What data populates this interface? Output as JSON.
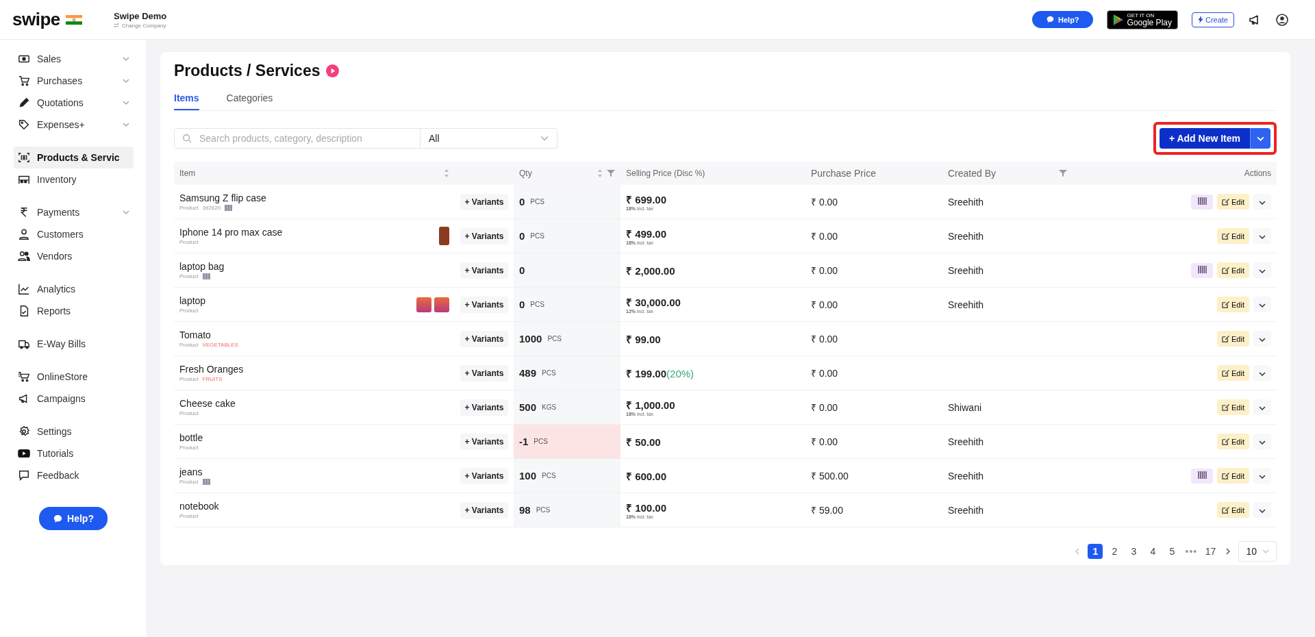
{
  "header": {
    "logo": "swipe",
    "company": "Swipe Demo",
    "change_company": "Change Company",
    "help": "Help?",
    "store_badge": {
      "small": "GET IT ON",
      "big": "Google Play"
    },
    "create": "Create"
  },
  "sidebar": {
    "groups": [
      {
        "items": [
          {
            "label": "Sales",
            "expandable": true,
            "selected": false
          },
          {
            "label": "Purchases",
            "expandable": true,
            "selected": false
          },
          {
            "label": "Quotations",
            "expandable": true,
            "selected": false
          },
          {
            "label": "Expenses+",
            "expandable": true,
            "selected": false
          }
        ]
      },
      {
        "items": [
          {
            "label": "Products & Servic",
            "expandable": false,
            "selected": true
          },
          {
            "label": "Inventory",
            "expandable": false,
            "selected": false
          }
        ]
      },
      {
        "items": [
          {
            "label": "Payments",
            "expandable": true,
            "selected": false
          },
          {
            "label": "Customers",
            "expandable": false,
            "selected": false
          },
          {
            "label": "Vendors",
            "expandable": false,
            "selected": false
          }
        ]
      },
      {
        "items": [
          {
            "label": "Analytics",
            "expandable": false,
            "selected": false
          },
          {
            "label": "Reports",
            "expandable": false,
            "selected": false
          }
        ]
      },
      {
        "items": [
          {
            "label": "E-Way Bills",
            "expandable": false,
            "selected": false
          }
        ]
      },
      {
        "items": [
          {
            "label": "OnlineStore",
            "expandable": false,
            "selected": false
          },
          {
            "label": "Campaigns",
            "expandable": false,
            "selected": false
          }
        ]
      },
      {
        "items": [
          {
            "label": "Settings",
            "expandable": false,
            "selected": false
          },
          {
            "label": "Tutorials",
            "expandable": false,
            "selected": false
          },
          {
            "label": "Feedback",
            "expandable": false,
            "selected": false
          }
        ]
      }
    ],
    "help": "Help?"
  },
  "page": {
    "title": "Products / Services",
    "tabs": [
      {
        "label": "Items",
        "selected": true
      },
      {
        "label": "Categories",
        "selected": false
      }
    ],
    "search": {
      "placeholder": "Search products, category, description"
    },
    "filter": {
      "value": "All"
    },
    "add_button": "+ Add New Item",
    "table": {
      "columns": [
        "Item",
        "Qty",
        "Selling Price (Disc %)",
        "Purchase Price",
        "Created By",
        "Actions"
      ],
      "rows": [
        {
          "name": "Samsung Z flip case",
          "type": "Product",
          "code": "392620",
          "category": "",
          "barcode": true,
          "thumbnails": [],
          "variants": "+ Variants",
          "qty": "0",
          "unit": "PCS",
          "negative": false,
          "price": "₹ 699.00",
          "discount": "",
          "tax_rate": "18%",
          "tax_note": "incl. tax",
          "purchase": "₹ 0.00",
          "created_by": "Sreehith",
          "barcode_action": true,
          "edit": "Edit"
        },
        {
          "name": "Iphone 14 pro max case",
          "type": "Product",
          "code": "",
          "category": "",
          "barcode": false,
          "thumbnails": [
            {
              "kind": "phone"
            }
          ],
          "variants": "+ Variants",
          "qty": "0",
          "unit": "PCS",
          "negative": false,
          "price": "₹ 499.00",
          "discount": "",
          "tax_rate": "18%",
          "tax_note": "incl. tax",
          "purchase": "₹ 0.00",
          "created_by": "Sreehith",
          "barcode_action": false,
          "edit": "Edit"
        },
        {
          "name": "laptop bag",
          "type": "Product",
          "code": "",
          "category": "",
          "barcode": true,
          "thumbnails": [],
          "variants": "+ Variants",
          "qty": "0",
          "unit": "",
          "negative": false,
          "price": "₹ 2,000.00",
          "discount": "",
          "tax_rate": "",
          "tax_note": "",
          "purchase": "₹ 0.00",
          "created_by": "Sreehith",
          "barcode_action": true,
          "edit": "Edit"
        },
        {
          "name": "laptop",
          "type": "Product",
          "code": "",
          "category": "",
          "barcode": false,
          "thumbnails": [
            {
              "kind": "laptop"
            },
            {
              "kind": "laptop"
            }
          ],
          "variants": "+ Variants",
          "qty": "0",
          "unit": "PCS",
          "negative": false,
          "price": "₹ 30,000.00",
          "discount": "",
          "tax_rate": "12%",
          "tax_note": "incl. tax",
          "purchase": "₹ 0.00",
          "created_by": "Sreehith",
          "barcode_action": false,
          "edit": "Edit"
        },
        {
          "name": "Tomato",
          "type": "Product",
          "code": "",
          "category": "VEGETABLES",
          "barcode": false,
          "thumbnails": [],
          "variants": "+ Variants",
          "qty": "1000",
          "unit": "PCS",
          "negative": false,
          "price": "₹ 99.00",
          "discount": "",
          "tax_rate": "",
          "tax_note": "",
          "purchase": "₹ 0.00",
          "created_by": "",
          "barcode_action": false,
          "edit": "Edit"
        },
        {
          "name": "Fresh Oranges",
          "type": "Product",
          "code": "",
          "category": "FRUITS",
          "barcode": false,
          "thumbnails": [],
          "variants": "+ Variants",
          "qty": "489",
          "unit": "PCS",
          "negative": false,
          "price": "₹ 199.00",
          "discount": "(20%)",
          "tax_rate": "",
          "tax_note": "",
          "purchase": "₹ 0.00",
          "created_by": "",
          "barcode_action": false,
          "edit": "Edit"
        },
        {
          "name": "Cheese cake",
          "type": "Product",
          "code": "",
          "category": "",
          "barcode": false,
          "thumbnails": [],
          "variants": "+ Variants",
          "qty": "500",
          "unit": "KGS",
          "negative": false,
          "price": "₹ 1,000.00",
          "discount": "",
          "tax_rate": "18%",
          "tax_note": "incl. tax",
          "purchase": "₹ 0.00",
          "created_by": "Shiwani",
          "barcode_action": false,
          "edit": "Edit"
        },
        {
          "name": "bottle",
          "type": "Product",
          "code": "",
          "category": "",
          "barcode": false,
          "thumbnails": [],
          "variants": "+ Variants",
          "qty": "-1",
          "unit": "PCS",
          "negative": true,
          "price": "₹ 50.00",
          "discount": "",
          "tax_rate": "",
          "tax_note": "",
          "purchase": "₹ 0.00",
          "created_by": "Sreehith",
          "barcode_action": false,
          "edit": "Edit"
        },
        {
          "name": "jeans",
          "type": "Product",
          "code": "",
          "category": "",
          "barcode": true,
          "thumbnails": [],
          "variants": "+ Variants",
          "qty": "100",
          "unit": "PCS",
          "negative": false,
          "price": "₹ 600.00",
          "discount": "",
          "tax_rate": "",
          "tax_note": "",
          "purchase": "₹ 500.00",
          "created_by": "Sreehith",
          "barcode_action": true,
          "edit": "Edit"
        },
        {
          "name": "notebook",
          "type": "Product",
          "code": "",
          "category": "",
          "barcode": false,
          "thumbnails": [],
          "variants": "+ Variants",
          "qty": "98",
          "unit": "PCS",
          "negative": false,
          "price": "₹ 100.00",
          "discount": "",
          "tax_rate": "18%",
          "tax_note": "incl. tax",
          "purchase": "₹ 59.00",
          "created_by": "Sreehith",
          "barcode_action": false,
          "edit": "Edit"
        }
      ]
    },
    "pagination": {
      "pages": [
        {
          "label": "1",
          "selected": true
        },
        {
          "label": "2",
          "selected": false
        },
        {
          "label": "3",
          "selected": false
        },
        {
          "label": "4",
          "selected": false
        },
        {
          "label": "5",
          "selected": false
        }
      ],
      "ellipsis": "•••",
      "last": "17",
      "page_size": "10"
    }
  }
}
